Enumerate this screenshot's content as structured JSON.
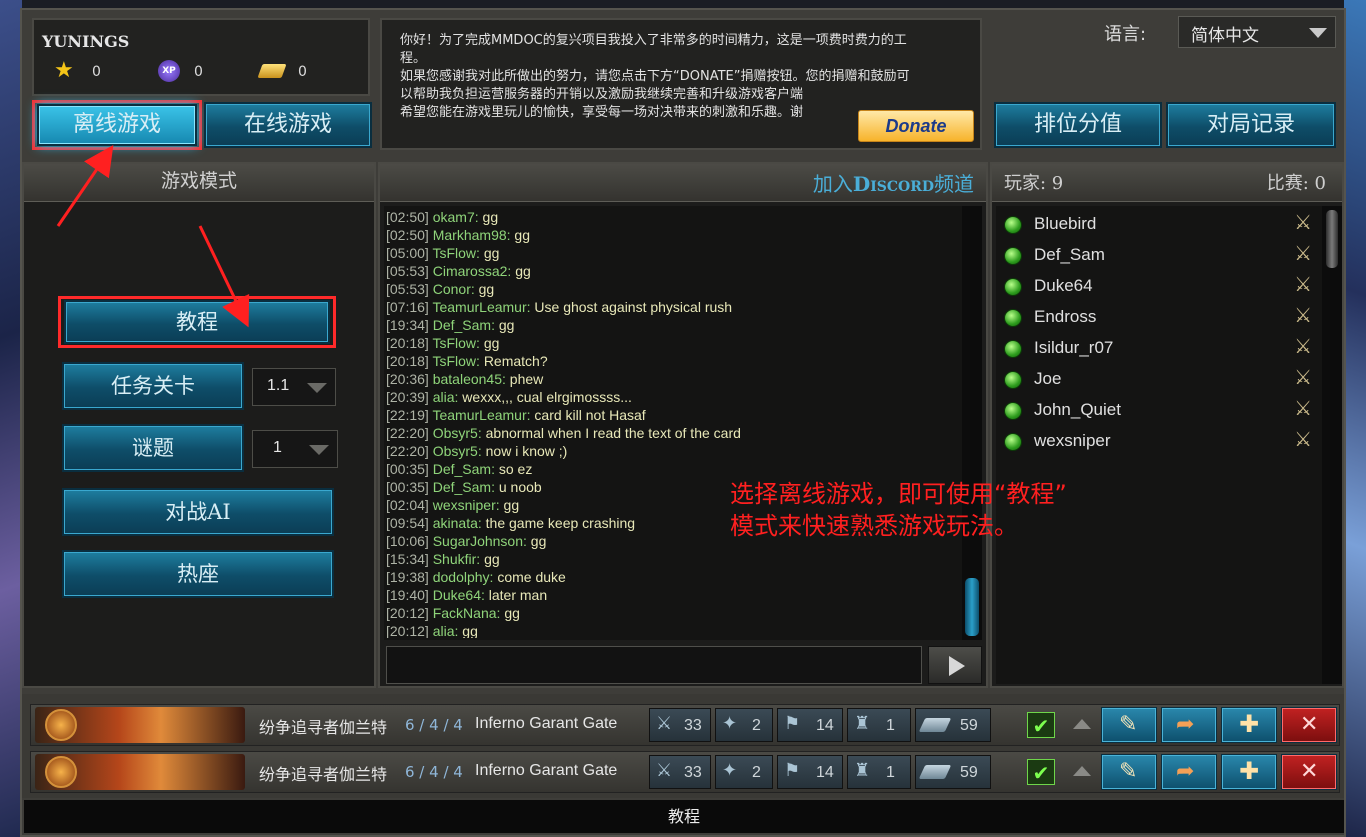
{
  "profile": {
    "name": "YUNINGS",
    "stars": "0",
    "xp_badge": "XP",
    "xp": "0",
    "gold": "0"
  },
  "mode_tabs": {
    "offline": "离线游戏",
    "online": "在线游戏"
  },
  "notice": {
    "text": "你好！为了完成MMDOC的复兴项目我投入了非常多的时间精力，这是一项费时费力的工程。\n如果您感谢我对此所做出的努力，请您点击下方“DONATE”捐赠按钮。您的捐赠和鼓励可以帮助我负担运营服务器的开销以及激励我继续完善和升级游戏客户端\n希望您能在游戏里玩儿的愉快，享受每一场对决带来的刺激和乐趣。谢",
    "donate": "Donate"
  },
  "language": {
    "label": "语言:",
    "selected": "简体中文"
  },
  "top_buttons": {
    "rank": "排位分值",
    "history": "对局记录"
  },
  "game_mode": {
    "title": "游戏模式",
    "tutorial": "教程",
    "campaign": "任务关卡",
    "campaign_value": "1.1",
    "puzzle": "谜题",
    "puzzle_value": "1",
    "vs_ai": "对战AI",
    "hotseat": "热座"
  },
  "chat": {
    "discord_prefix": "加入",
    "discord_brand": "Discord",
    "discord_suffix": "频道",
    "messages": [
      {
        "time": "[02:50]",
        "user": "okam7:",
        "msg": "gg"
      },
      {
        "time": "[02:50]",
        "user": "Markham98:",
        "msg": "gg"
      },
      {
        "time": "[05:00]",
        "user": "TsFlow:",
        "msg": "gg"
      },
      {
        "time": "[05:53]",
        "user": "Cimarossa2:",
        "msg": "gg"
      },
      {
        "time": "[05:53]",
        "user": "Conor:",
        "msg": "gg"
      },
      {
        "time": "[07:16]",
        "user": "TeamurLeamur:",
        "msg": "Use ghost against physical rush"
      },
      {
        "time": "[19:34]",
        "user": "Def_Sam:",
        "msg": "gg"
      },
      {
        "time": "[20:18]",
        "user": "TsFlow:",
        "msg": "gg"
      },
      {
        "time": "[20:18]",
        "user": "TsFlow:",
        "msg": "Rematch?"
      },
      {
        "time": "[20:36]",
        "user": "bataleon45:",
        "msg": "phew"
      },
      {
        "time": "[20:39]",
        "user": "alia:",
        "msg": "wexxx,,, cual elrgimossss..."
      },
      {
        "time": "[22:19]",
        "user": "TeamurLeamur:",
        "msg": "card kill not Hasaf"
      },
      {
        "time": "[22:20]",
        "user": "Obsyr5:",
        "msg": "abnormal when I read the text of the card"
      },
      {
        "time": "[22:20]",
        "user": "Obsyr5:",
        "msg": "now i know ;)"
      },
      {
        "time": "[00:35]",
        "user": "Def_Sam:",
        "msg": "so ez"
      },
      {
        "time": "[00:35]",
        "user": "Def_Sam:",
        "msg": "u noob"
      },
      {
        "time": "[02:04]",
        "user": "wexsniper:",
        "msg": "gg"
      },
      {
        "time": "[09:54]",
        "user": "akinata:",
        "msg": "the game keep crashing"
      },
      {
        "time": "[10:06]",
        "user": "SugarJohnson:",
        "msg": "gg"
      },
      {
        "time": "[15:34]",
        "user": "Shukfir:",
        "msg": "gg"
      },
      {
        "time": "[19:38]",
        "user": "dodolphy:",
        "msg": "come duke"
      },
      {
        "time": "[19:40]",
        "user": "Duke64:",
        "msg": "later man"
      },
      {
        "time": "[20:12]",
        "user": "FackNana:",
        "msg": "gg"
      },
      {
        "time": "[20:12]",
        "user": "alia:",
        "msg": "gg"
      }
    ],
    "input_value": ""
  },
  "players": {
    "label": "玩家: 9",
    "matches": "比赛: 0",
    "list": [
      "Bluebird",
      "Def_Sam",
      "Duke64",
      "Endross",
      "Isildur_r07",
      "Joe",
      "John_Quiet",
      "wexsniper"
    ]
  },
  "annotation": {
    "line1": "选择离线游戏，即可使用“教程”",
    "line2": "模式来快速熟悉游戏玩法。"
  },
  "decks": [
    {
      "hero": "纷争追寻者伽兰特",
      "stats": "6 / 4 / 4",
      "name": "Inferno Garant Gate",
      "might": "33",
      "magic": "2",
      "banner": "14",
      "fort": "1",
      "total": "59"
    },
    {
      "hero": "纷争追寻者伽兰特",
      "stats": "6 / 4 / 4",
      "name": "Inferno Garant Gate",
      "might": "33",
      "magic": "2",
      "banner": "14",
      "fort": "1",
      "total": "59"
    }
  ],
  "status_bar": "教程",
  "colors": {
    "accent_blue": "#1688b0",
    "annotation_red": "#ff2020",
    "chat_user": "#8fd47a"
  }
}
